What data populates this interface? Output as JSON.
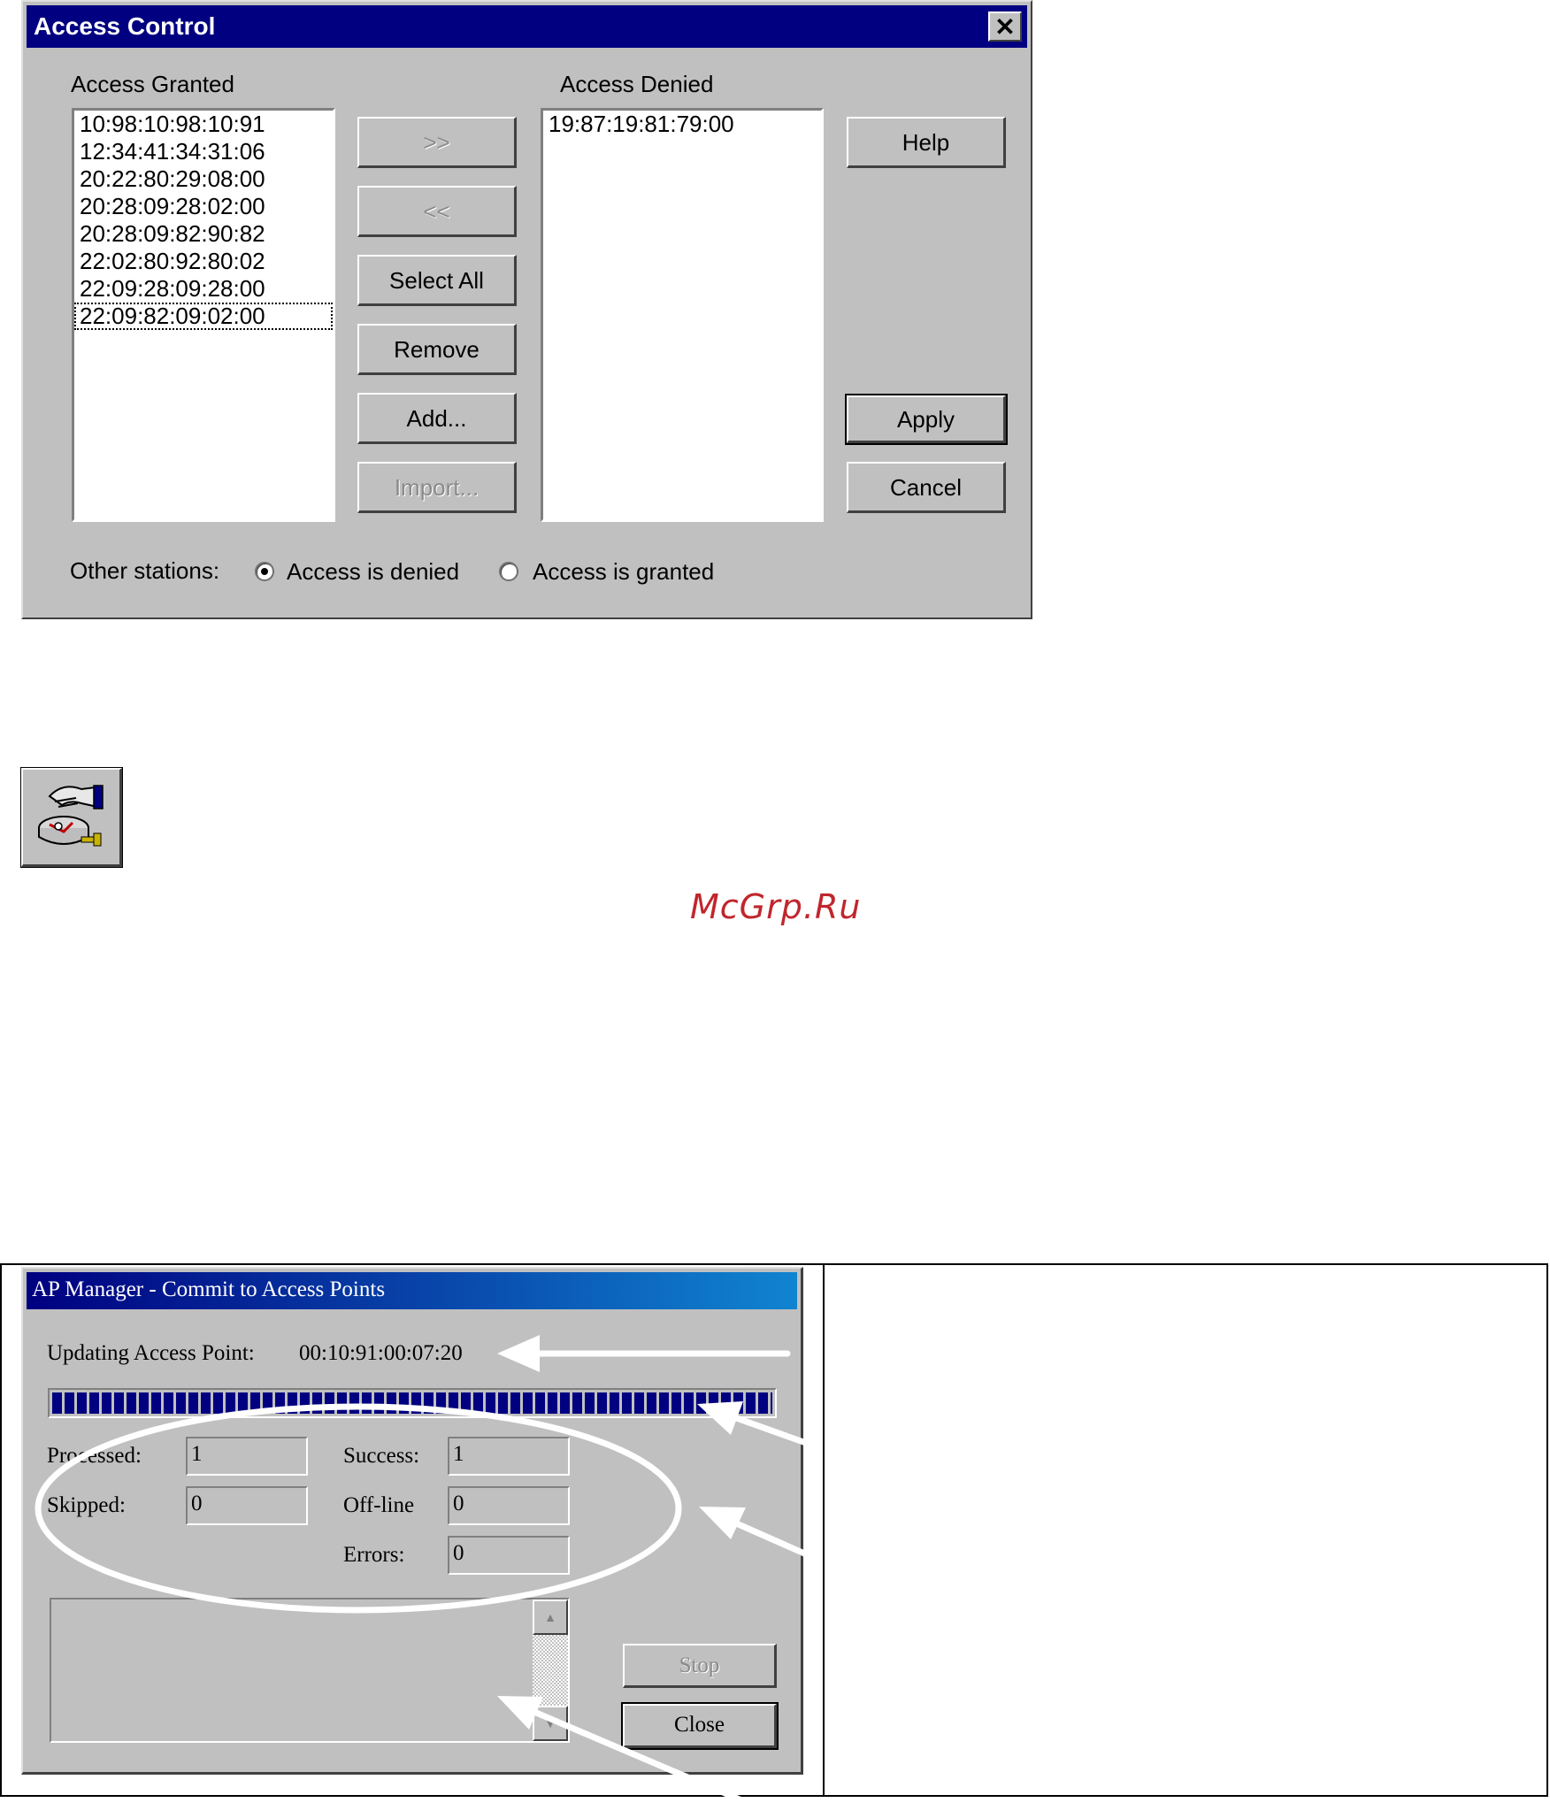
{
  "access_control": {
    "title": "Access Control",
    "close_glyph": "✕",
    "granted_label": "Access Granted",
    "denied_label": "Access Denied",
    "granted_list": [
      "10:98:10:98:10:91",
      "12:34:41:34:31:06",
      "20:22:80:29:08:00",
      "20:28:09:28:02:00",
      "20:28:09:82:90:82",
      "22:02:80:92:80:02",
      "22:09:28:09:28:00",
      "22:09:82:09:02:00"
    ],
    "denied_list": [
      "19:87:19:81:79:00"
    ],
    "buttons": {
      "move_right": ">>",
      "move_left": "<<",
      "select_all": "Select All",
      "remove": "Remove",
      "add": "Add...",
      "import": "Import...",
      "help": "Help",
      "apply": "Apply",
      "cancel": "Cancel"
    },
    "other_stations_label": "Other stations:",
    "radio_denied": "Access is denied",
    "radio_granted": "Access is granted",
    "selected_radio": "denied"
  },
  "toolbar_icon": {
    "icon": "access-control-toolbar-icon"
  },
  "watermark": "McGrp.Ru",
  "commit_dialog": {
    "title": "AP Manager - Commit to Access Points",
    "updating_label": "Updating Access Point:",
    "updating_value": "00:10:91:00:07:20",
    "progress": 1.0,
    "labels": {
      "processed": "Processed:",
      "success": "Success:",
      "skipped": "Skipped:",
      "offline": "Off-line",
      "errors": "Errors:"
    },
    "values": {
      "processed": "1",
      "success": "1",
      "skipped": "0",
      "offline": "0",
      "errors": "0"
    },
    "buttons": {
      "stop": "Stop",
      "close": "Close"
    }
  },
  "colors": {
    "dialog_bg": "#c0c0c0",
    "title_bar": "#000080",
    "watermark": "#c0262d"
  }
}
